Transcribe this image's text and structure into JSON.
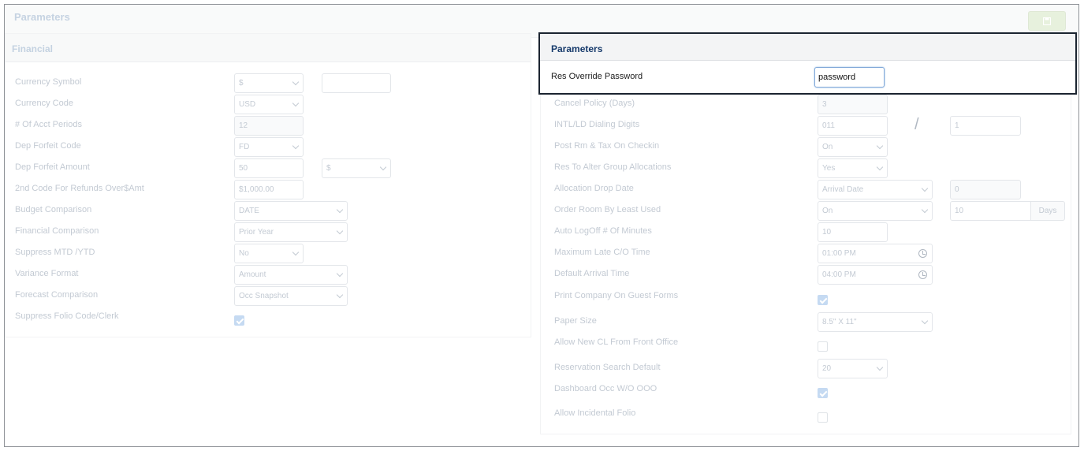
{
  "page": {
    "title": "Parameters"
  },
  "financial": {
    "title": "Financial",
    "rows": [
      {
        "label": "Currency Symbol",
        "value": "$",
        "extra": ""
      },
      {
        "label": "Currency Code",
        "value": "USD"
      },
      {
        "label": "# Of Acct Periods",
        "value": "12"
      },
      {
        "label": "Dep Forfeit Code",
        "value": "FD"
      },
      {
        "label": "Dep Forfeit Amount",
        "value": "50",
        "extra": "$"
      },
      {
        "label": "2nd Code For Refunds Over$Amt",
        "value": "$1,000.00"
      },
      {
        "label": "Budget Comparison",
        "value": "DATE"
      },
      {
        "label": "Financial Comparison",
        "value": "Prior Year"
      },
      {
        "label": "Suppress MTD /YTD",
        "value": "No"
      },
      {
        "label": "Variance Format",
        "value": "Amount"
      },
      {
        "label": "Forecast Comparison",
        "value": "Occ Snapshot"
      },
      {
        "label": "Suppress Folio Code/Clerk",
        "checked": true
      }
    ]
  },
  "parameters": {
    "title": "Parameters",
    "override": {
      "label": "Res Override Password",
      "value": "password"
    },
    "rows": [
      {
        "label": "Cancel Policy (Days)",
        "value": "3"
      },
      {
        "label": "INTL/LD Dialing Digits",
        "value": "011",
        "separator": "/",
        "extra": "1"
      },
      {
        "label": "Post Rm & Tax On Checkin",
        "value": "On"
      },
      {
        "label": "Res To Alter Group Allocations",
        "value": "Yes"
      },
      {
        "label": "Allocation Drop Date",
        "value": "Arrival Date",
        "extra": "0"
      },
      {
        "label": "Order Room By Least Used",
        "value": "On",
        "extra": "10",
        "addon": "Days"
      },
      {
        "label": "Auto LogOff # Of Minutes",
        "value": "10"
      },
      {
        "label": "Maximum Late C/O Time",
        "value": "01:00 PM"
      },
      {
        "label": "Default Arrival Time",
        "value": "04:00 PM"
      },
      {
        "label": "Print Company On Guest Forms",
        "checked": true
      },
      {
        "label": "Paper Size",
        "value": "8.5\" X 11\""
      },
      {
        "label": "Allow New CL From Front Office",
        "checked": false
      },
      {
        "label": "Reservation Search Default",
        "value": "20"
      },
      {
        "label": "Dashboard Occ W/O OOO",
        "checked": true
      },
      {
        "label": "Allow Incidental Folio",
        "checked": false
      }
    ]
  }
}
